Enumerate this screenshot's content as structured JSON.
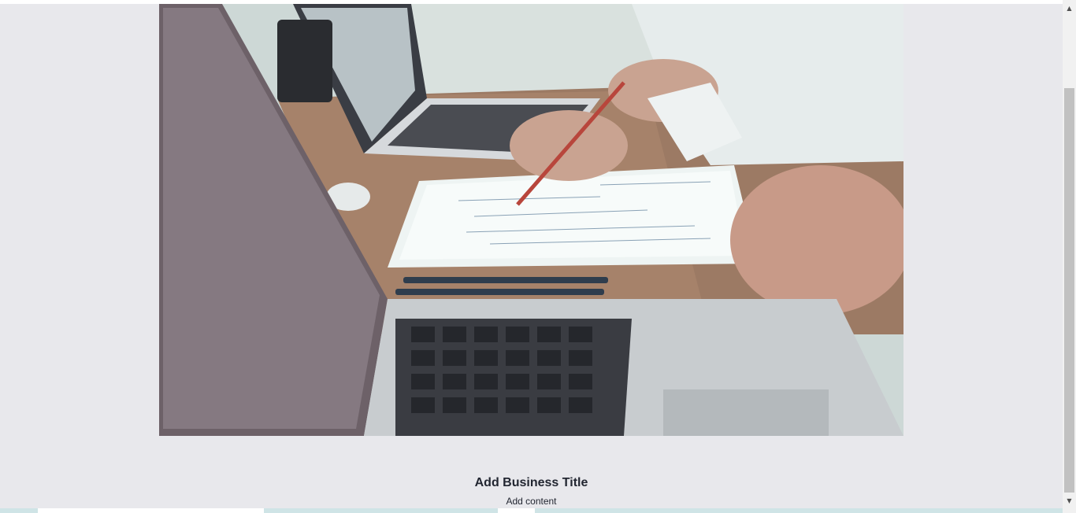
{
  "hero": {
    "image_name": "business-desk-photo"
  },
  "business": {
    "title": "Add Business Title",
    "content": "Add content"
  },
  "scrollbar": {
    "up_arrow": "▲",
    "down_arrow": "▼"
  }
}
